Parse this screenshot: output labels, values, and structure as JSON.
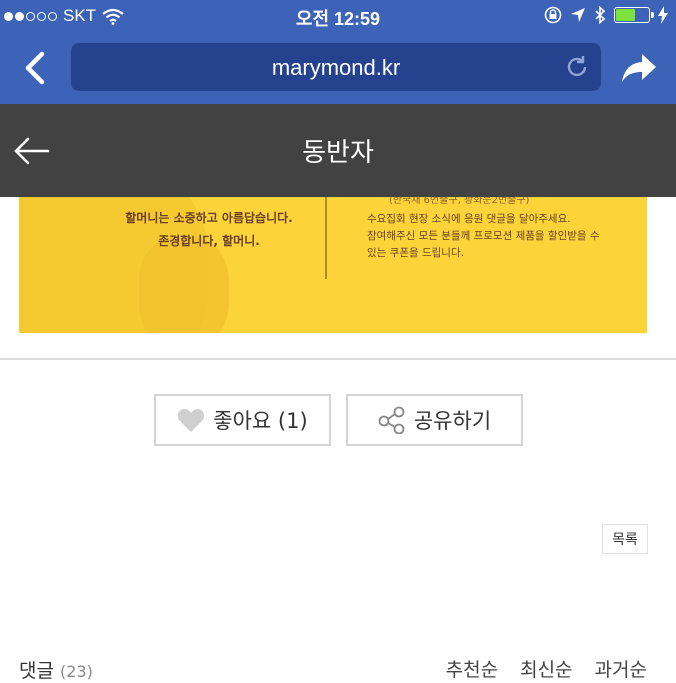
{
  "status_bar": {
    "carrier": "SKT",
    "time": "오전 12:59",
    "signal_bars": 5,
    "signal_filled": 2,
    "battery_level": 0.6,
    "battery_color": "#7ee13c"
  },
  "browser": {
    "url": "marymond.kr",
    "bar_color": "#3c63b7",
    "field_color": "#24428d"
  },
  "header": {
    "title": "동반자",
    "bg_color": "#424242"
  },
  "banner": {
    "top_partial": "(한국채 6번출구, 광화문2번출구)",
    "left_line1": "할머니는 소중하고 아름답습니다.",
    "left_line2": "존경합니다, 할머니.",
    "right_line1": "수요집회 현장 소식에 응원 댓글을 달아주세요.",
    "right_line2": "참여해주신 모든 분들께 프로모션 제품을 할인받을 수",
    "right_line3": "있는 쿠폰을 드립니다.",
    "color": "#fcd43a"
  },
  "actions": {
    "like_label": "좋아요 (1)",
    "share_label": "공유하기"
  },
  "list_button": "목록",
  "comments": {
    "label": "댓글",
    "count": "(23)"
  },
  "sort_options": [
    "추천순",
    "최신순",
    "과거순"
  ],
  "icons": {
    "back": "chevron-left-icon",
    "reload": "reload-icon",
    "share": "share-arrow-icon",
    "header_back": "arrow-left-icon",
    "heart": "heart-icon",
    "share_nodes": "share-nodes-icon"
  }
}
